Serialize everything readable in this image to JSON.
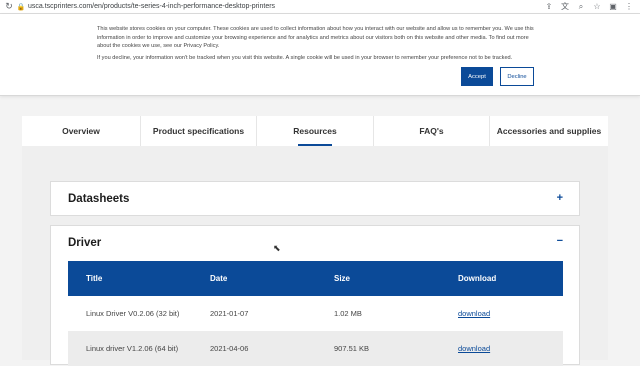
{
  "browser": {
    "url": "usca.tscprinters.com/en/products/te-series-4-inch-performance-desktop-printers"
  },
  "cookie_banner": {
    "text1": "This website stores cookies on your computer. These cookies are used to collect information about how you interact with our website and allow us to remember you. We use this information in order to improve and customize your browsing experience and for analytics and metrics about our visitors both on this website and other media. To find out more about the cookies we use, see our Privacy Policy.",
    "text2": "If you decline, your information won't be tracked when you visit this website. A single cookie will be used in your browser to remember your preference not to be tracked.",
    "accept_label": "Accept",
    "decline_label": "Decline"
  },
  "tabs": [
    {
      "label": "Overview"
    },
    {
      "label": "Product specifications"
    },
    {
      "label": "Resources"
    },
    {
      "label": "FAQ's"
    },
    {
      "label": "Accessories and supplies"
    }
  ],
  "datasheets": {
    "title": "Datasheets",
    "toggle": "+"
  },
  "driver": {
    "title": "Driver",
    "toggle": "−",
    "headers": [
      "Title",
      "Date",
      "Size",
      "Download"
    ],
    "rows": [
      {
        "title": "Linux Driver V0.2.06 (32 bit)",
        "date": "2021-01-07",
        "size": "1.02 MB",
        "download": "download"
      },
      {
        "title": "Linux driver V1.2.06 (64 bit)",
        "date": "2021-04-06",
        "size": "907.51 KB",
        "download": "download"
      }
    ]
  },
  "colors": {
    "brand": "#0b4a98",
    "page_bg": "#efefef"
  }
}
